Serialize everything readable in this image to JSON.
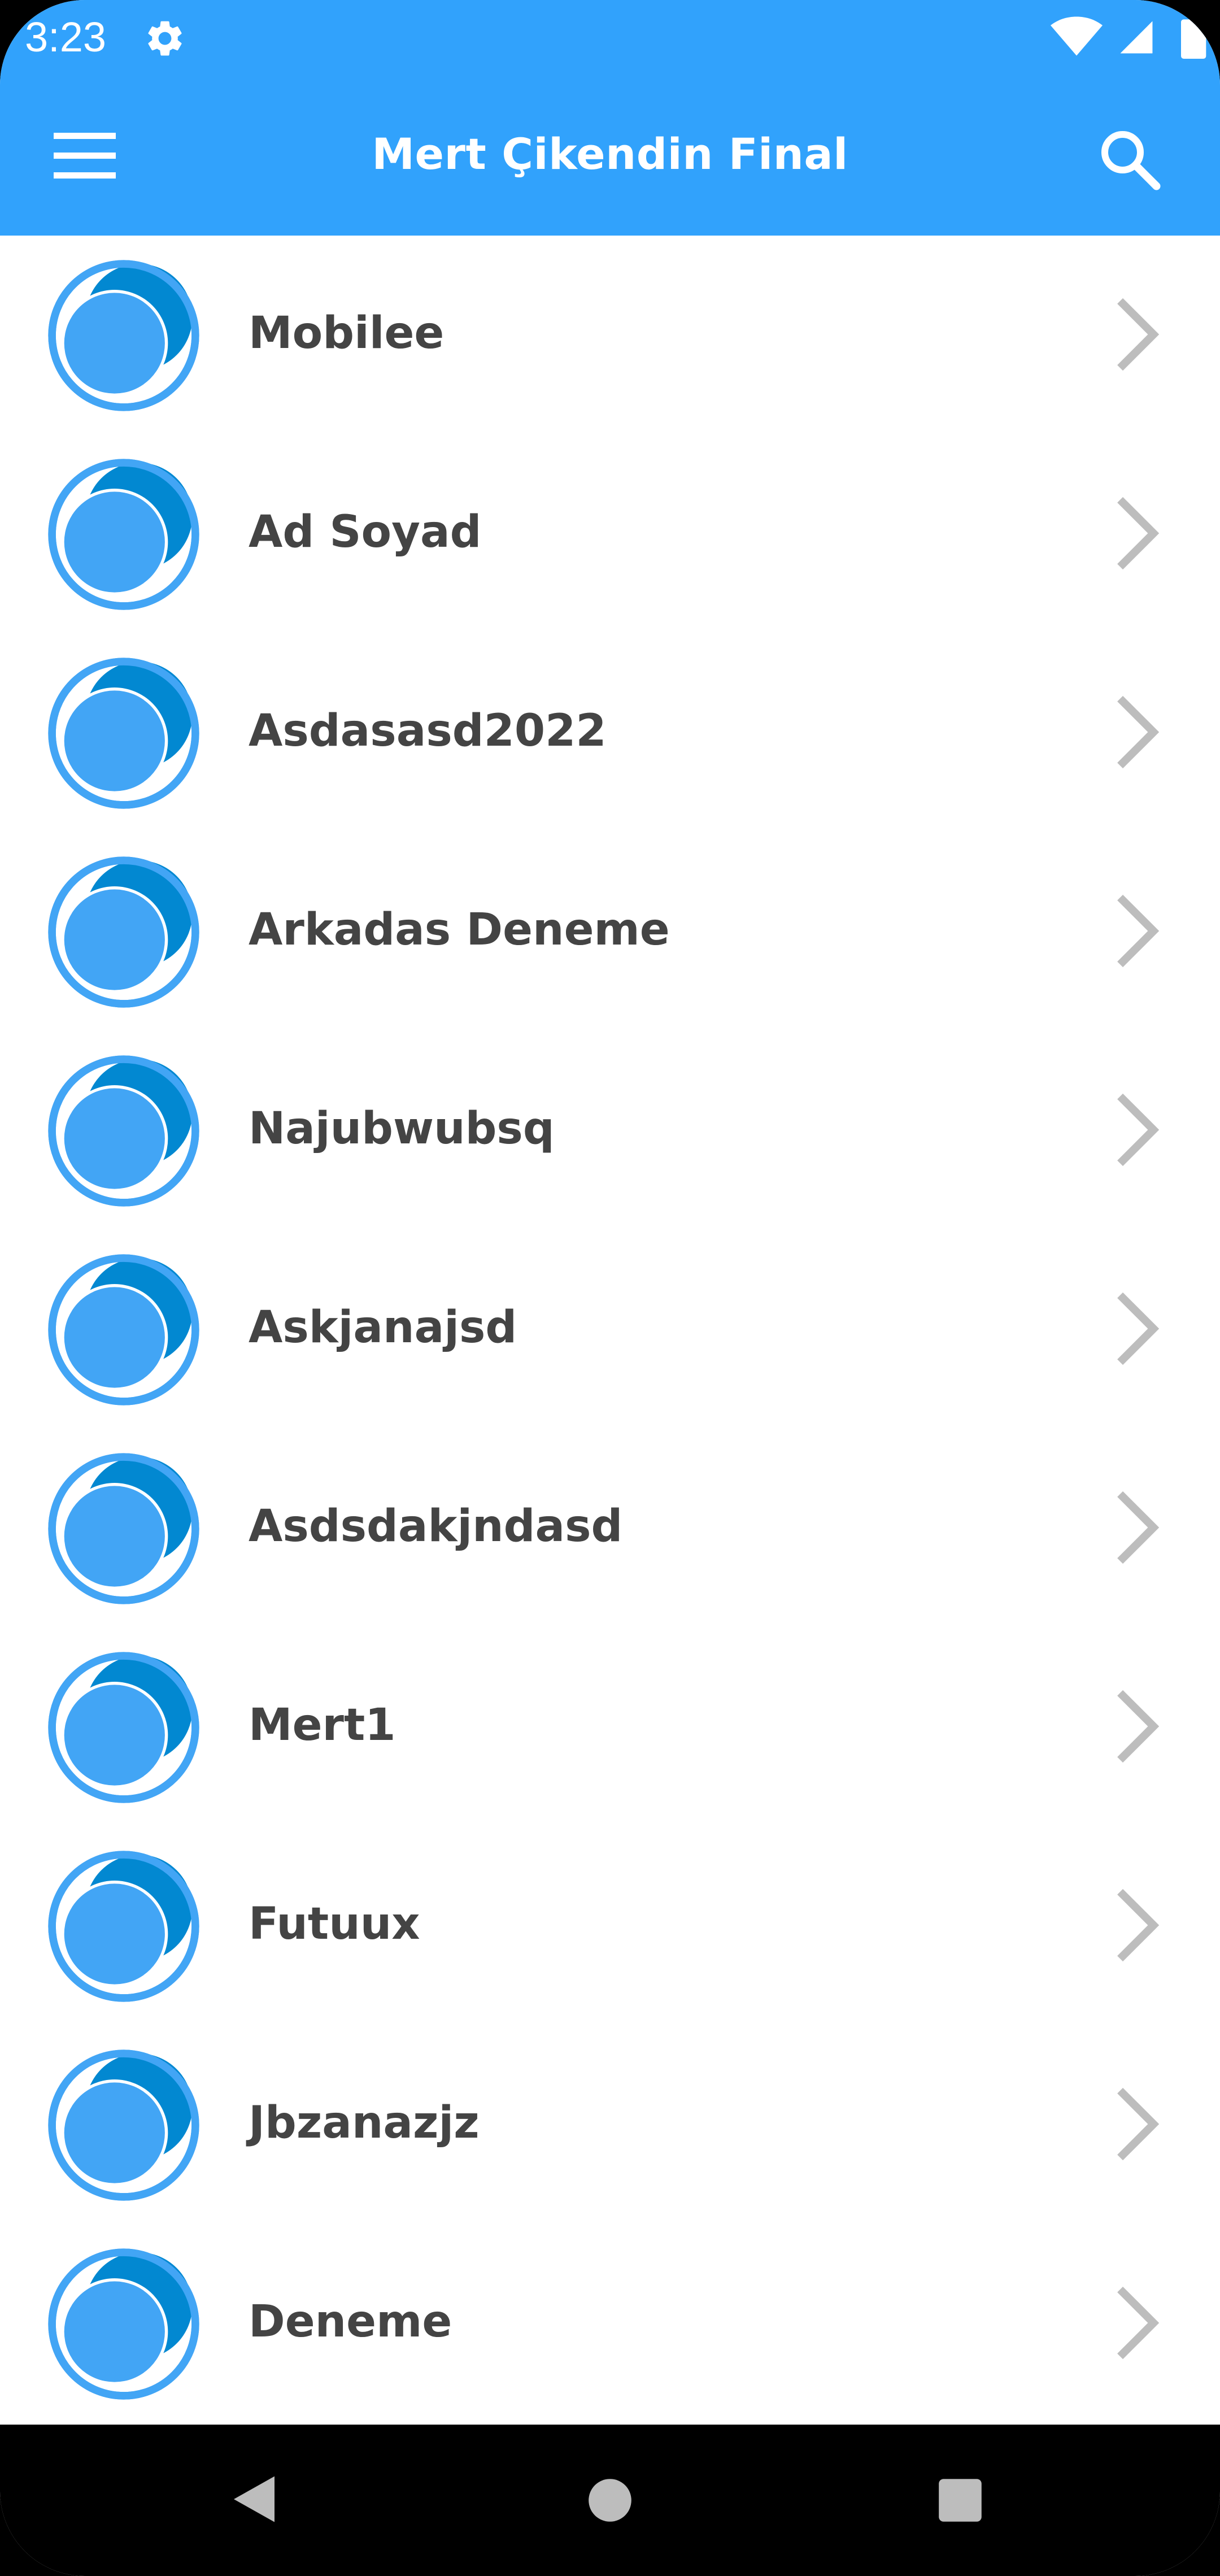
{
  "status_bar": {
    "time": "3:23",
    "icons": [
      "settings-gear-icon",
      "wifi-icon",
      "cell-signal-icon",
      "battery-icon"
    ]
  },
  "app_bar": {
    "title": "Mert Çikendin Final",
    "menu_icon": "hamburger-menu-icon",
    "search_icon": "search-icon"
  },
  "list": {
    "items": [
      {
        "label": "Mobilee"
      },
      {
        "label": "Ad Soyad"
      },
      {
        "label": "Asdasasd2022"
      },
      {
        "label": "Arkadas Deneme"
      },
      {
        "label": "Najubwubsq"
      },
      {
        "label": "Askjanajsd"
      },
      {
        "label": "Asdsdakjndasd"
      },
      {
        "label": "Mert1"
      },
      {
        "label": "Futuux"
      },
      {
        "label": "Jbzanazjz"
      },
      {
        "label": "Deneme"
      }
    ]
  },
  "nav_bar": {
    "icons": [
      "back-icon",
      "home-icon",
      "recents-icon"
    ]
  },
  "colors": {
    "primary": "#31a2fc",
    "avatar_light": "#42a5f5",
    "avatar_dark": "#0288d1",
    "label_text": "#444444",
    "chevron": "#bdbdbd"
  }
}
